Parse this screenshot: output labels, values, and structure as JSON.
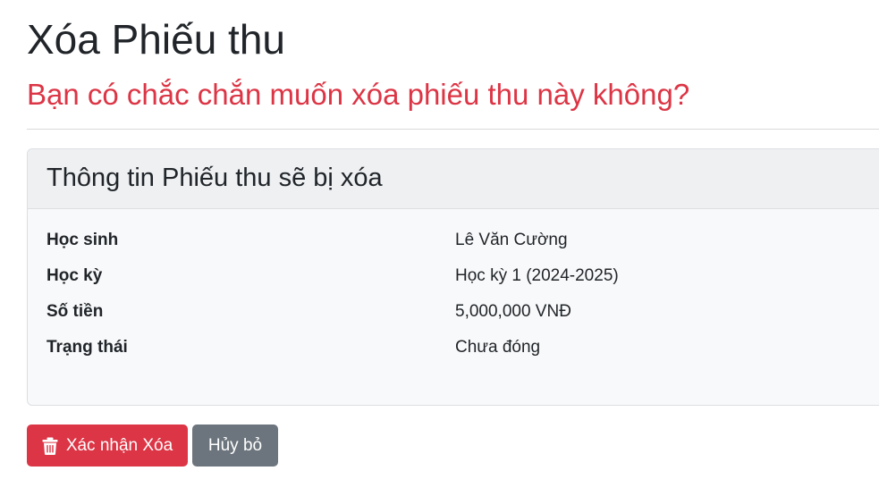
{
  "page": {
    "title": "Xóa Phiếu thu",
    "warning": "Bạn có chắc chắn muốn xóa phiếu thu này không?"
  },
  "card": {
    "header": "Thông tin Phiếu thu sẽ bị xóa",
    "rows": [
      {
        "label": "Học sinh",
        "value": "Lê Văn Cường"
      },
      {
        "label": "Học kỳ",
        "value": "Học kỳ 1 (2024-2025)"
      },
      {
        "label": "Số tiền",
        "value": "5,000,000 VNĐ"
      },
      {
        "label": "Trạng thái",
        "value": "Chưa đóng"
      }
    ]
  },
  "actions": {
    "confirm_label": "Xác nhận Xóa",
    "confirm_icon": "trash-icon",
    "cancel_label": "Hủy bỏ"
  },
  "colors": {
    "danger": "#dc3545",
    "secondary": "#6c757d"
  }
}
